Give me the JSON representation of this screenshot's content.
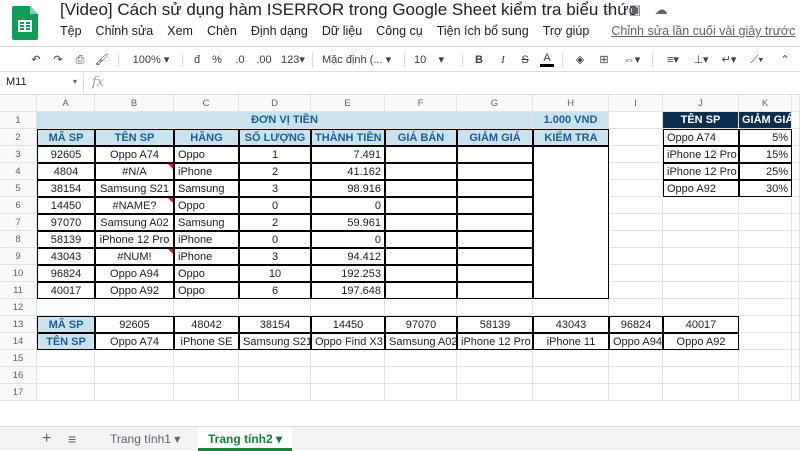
{
  "app": {
    "doc_title": "[Video] Cách sử dụng hàm ISERROR trong Google Sheet kiểm tra biểu thức",
    "menu": [
      "Tệp",
      "Chỉnh sửa",
      "Xem",
      "Chèn",
      "Định dạng",
      "Dữ liệu",
      "Công cụ",
      "Tiện ích bổ sung",
      "Trợ giúp"
    ],
    "last_edit": "Chỉnh sửa lần cuối vài giây trước"
  },
  "toolbar": {
    "zoom": "100%",
    "currency": "đ",
    "percent": "%",
    "dec_less": ".0",
    "dec_more": ".00",
    "num_format": "123",
    "font": "Mặc định (...",
    "font_size": "10",
    "bold": "B",
    "italic": "I",
    "strike": "S",
    "text_color": "A"
  },
  "formula_bar": {
    "cell_ref": "M11",
    "fx": "fx",
    "value": ""
  },
  "columns": [
    "A",
    "B",
    "C",
    "D",
    "E",
    "F",
    "G",
    "H",
    "I",
    "J",
    "K"
  ],
  "rows": [
    "1",
    "2",
    "3",
    "4",
    "5",
    "6",
    "7",
    "8",
    "9",
    "10",
    "11",
    "12",
    "13",
    "14",
    "15",
    "16",
    "17"
  ],
  "table1": {
    "banner": "ĐƠN VỊ TIỀN",
    "unit": "1.000 VND",
    "headers": [
      "MÃ SP",
      "TÊN SP",
      "HÃNG",
      "SỐ LƯỢNG",
      "THÀNH TIỀN",
      "GIÁ BÁN",
      "GIẢM GIÁ",
      "KIỂM TRA"
    ],
    "rows": [
      [
        "92605",
        "Oppo A74",
        "Oppo",
        "1",
        "7.491"
      ],
      [
        "4804",
        "#N/A",
        "iPhone",
        "2",
        "41.162"
      ],
      [
        "38154",
        "Samsung S21",
        "Samsung",
        "3",
        "98.916"
      ],
      [
        "14450",
        "#NAME?",
        "Oppo",
        "0",
        "0"
      ],
      [
        "97070",
        "Samsung A02",
        "Samsung",
        "2",
        "59.961"
      ],
      [
        "58139",
        "iPhone 12 Pro",
        "iPhone",
        "0",
        "0"
      ],
      [
        "43043",
        "#NUM!",
        "iPhone",
        "3",
        "94.412"
      ],
      [
        "96824",
        "Oppo A94",
        "Oppo",
        "10",
        "192.253"
      ],
      [
        "40017",
        "Oppo A92",
        "Oppo",
        "6",
        "197.648"
      ]
    ]
  },
  "table2": {
    "headers": [
      "TÊN SP",
      "GIẢM GIÁ"
    ],
    "rows": [
      [
        "Oppo A74",
        "5%"
      ],
      [
        "iPhone 12 Pro",
        "15%"
      ],
      [
        "iPhone 12 Pro",
        "25%"
      ],
      [
        "Oppo A92",
        "30%"
      ]
    ]
  },
  "table3": {
    "row_labels": [
      "MÃ SP",
      "TÊN SP"
    ],
    "codes": [
      "92605",
      "48042",
      "38154",
      "14450",
      "97070",
      "58139",
      "43043",
      "96824",
      "40017"
    ],
    "names": [
      "Oppo A74",
      "iPhone SE",
      "Samsung S21",
      "Oppo Find X3",
      "Samsung A02",
      "iPhone 12 Pro",
      "iPhone 11",
      "Oppo A94",
      "Oppo A92"
    ]
  },
  "sheets": {
    "tab1": "Trang tính1",
    "tab2": "Trang tính2"
  },
  "colors": {
    "header_fill": "#c9e3ee",
    "header_text": "#1f5c96",
    "dark_fill": "#0b2e4f",
    "active_tab": "#188038"
  }
}
